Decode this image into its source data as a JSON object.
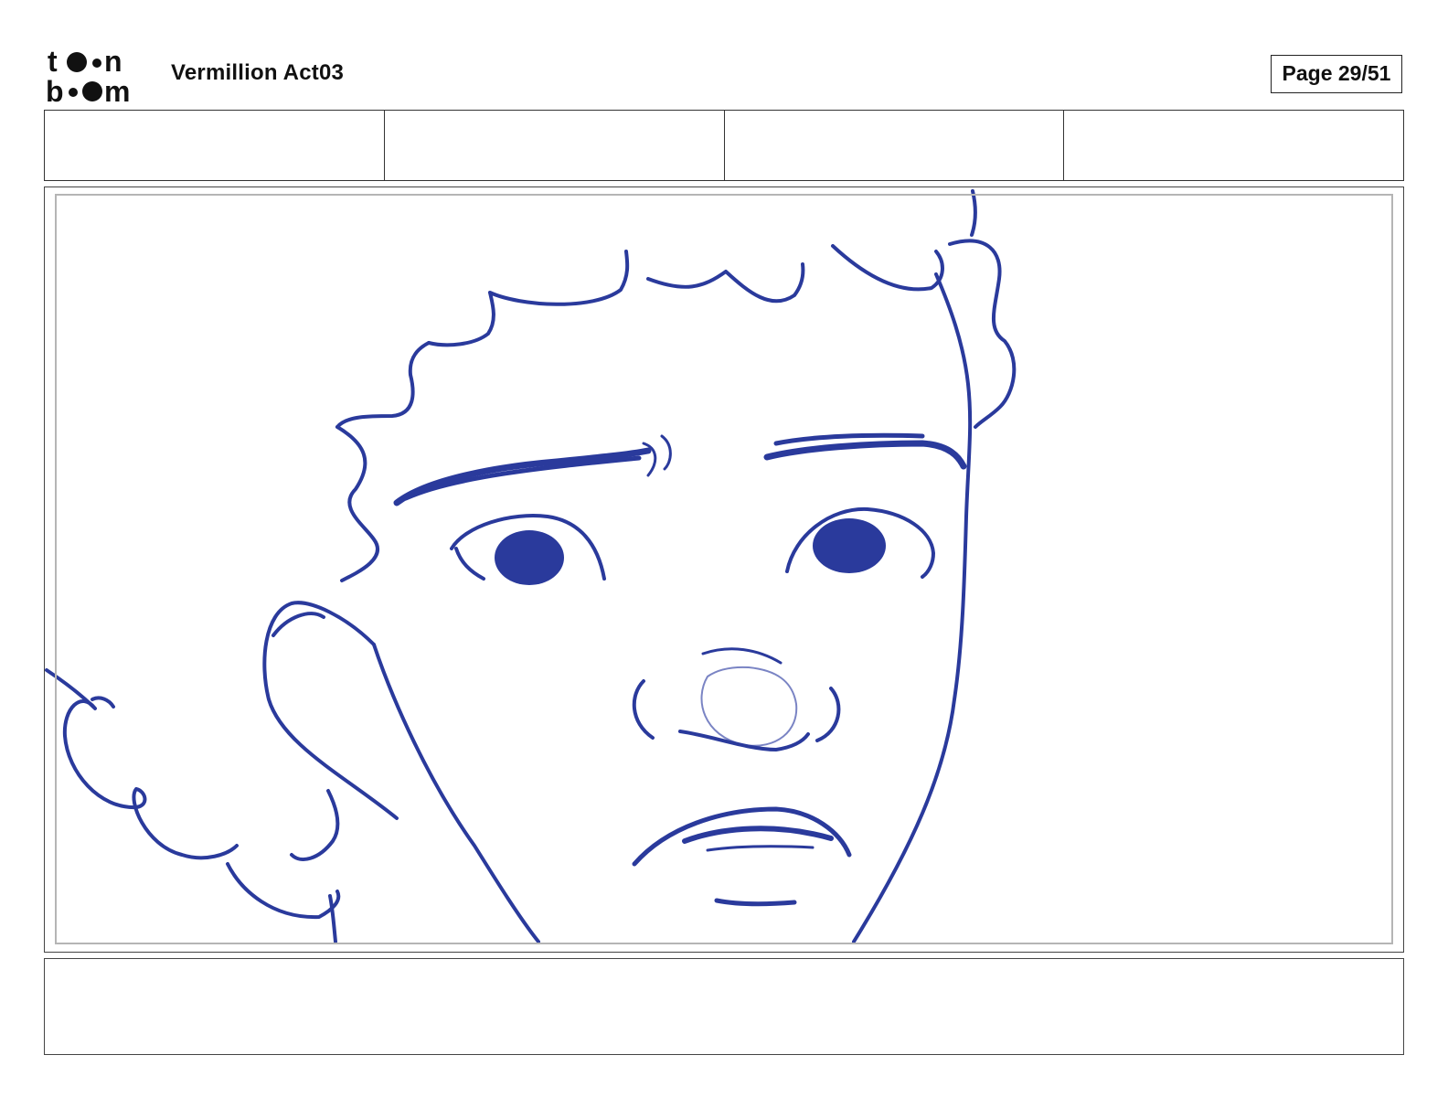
{
  "header": {
    "logo_text": "toonboom",
    "project_title": "Vermillion Act03",
    "page_label": "Page 29/51"
  },
  "header_cells": [
    "",
    "",
    "",
    ""
  ],
  "panel": {
    "sketch_subject": "character-face-closeup",
    "ink_color": "#2a3a9c"
  },
  "notes": {
    "text": ""
  }
}
